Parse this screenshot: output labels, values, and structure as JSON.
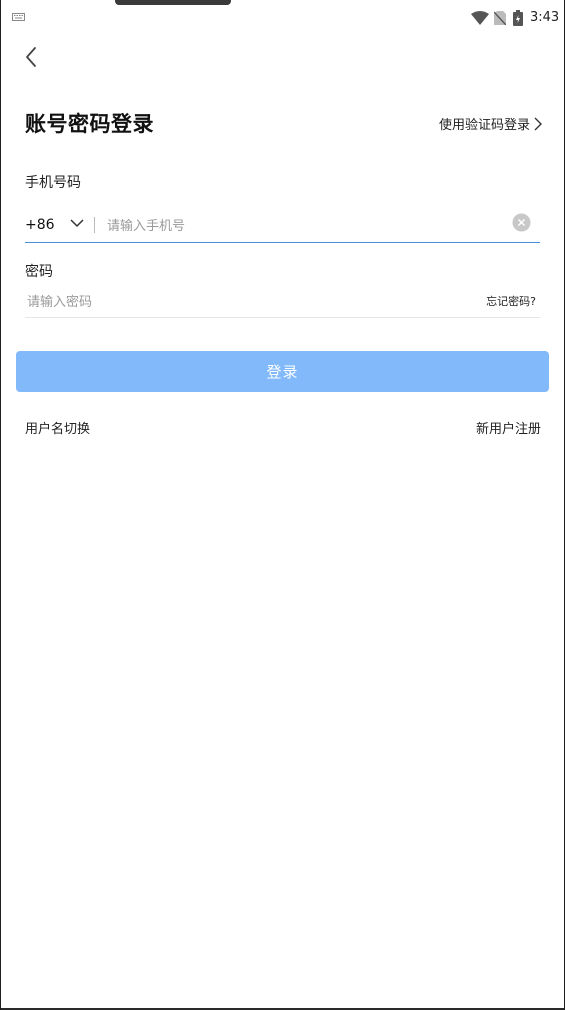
{
  "status_bar": {
    "time": "3:43",
    "icons": [
      "keyboard-icon",
      "wifi-icon",
      "no-sim-icon",
      "battery-icon"
    ]
  },
  "header": {
    "title": "账号密码登录",
    "switch_link": "使用验证码登录"
  },
  "phone": {
    "label": "手机号码",
    "country_code": "+86",
    "placeholder": "请输入手机号",
    "value": ""
  },
  "password": {
    "label": "密码",
    "placeholder": "请输入密码",
    "value": "",
    "forgot_label": "忘记密码?"
  },
  "login_button": {
    "label": "登录",
    "color": "#82b9fb"
  },
  "footer": {
    "switch_username": "用户名切换",
    "register": "新用户注册"
  },
  "colors": {
    "input_active_underline": "#4a8fd6",
    "background": "#ffffff"
  }
}
